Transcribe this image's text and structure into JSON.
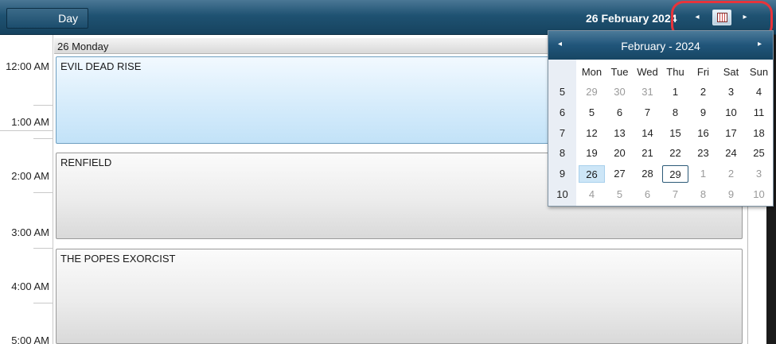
{
  "toolbar": {
    "view_button_label": "Day",
    "current_date": "26 February 2024",
    "prev_arrow": "◂",
    "next_arrow": "▸"
  },
  "day_header": {
    "label": "26 Monday"
  },
  "time_slots": [
    "12:00 AM",
    "1:00 AM",
    "2:00 AM",
    "3:00 AM",
    "4:00 AM",
    "5:00 AM"
  ],
  "appointments": [
    {
      "title": "EVIL DEAD RISE",
      "selected": true
    },
    {
      "title": "RENFIELD",
      "selected": false
    },
    {
      "title": "THE POPES EXORCIST",
      "selected": false
    }
  ],
  "mini_calendar": {
    "title": "February - 2024",
    "prev_arrow": "◂",
    "next_arrow": "▸",
    "weekdays": [
      "Mon",
      "Tue",
      "Wed",
      "Thu",
      "Fri",
      "Sat",
      "Sun"
    ],
    "weeks": [
      {
        "number": "5",
        "days": [
          "29",
          "30",
          "31",
          "1",
          "2",
          "3",
          "4"
        ]
      },
      {
        "number": "6",
        "days": [
          "5",
          "6",
          "7",
          "8",
          "9",
          "10",
          "11"
        ]
      },
      {
        "number": "7",
        "days": [
          "12",
          "13",
          "14",
          "15",
          "16",
          "17",
          "18"
        ]
      },
      {
        "number": "8",
        "days": [
          "19",
          "20",
          "21",
          "22",
          "23",
          "24",
          "25"
        ]
      },
      {
        "number": "9",
        "days": [
          "26",
          "27",
          "28",
          "29",
          "1",
          "2",
          "3"
        ]
      },
      {
        "number": "10",
        "days": [
          "4",
          "5",
          "6",
          "7",
          "8",
          "9",
          "10"
        ]
      }
    ],
    "selected_day": "26",
    "today_day": "29"
  },
  "colors": {
    "header_blue": "#1f5272",
    "selected_appointment": "#d6ecfb",
    "highlight_ring": "#e8343b"
  }
}
